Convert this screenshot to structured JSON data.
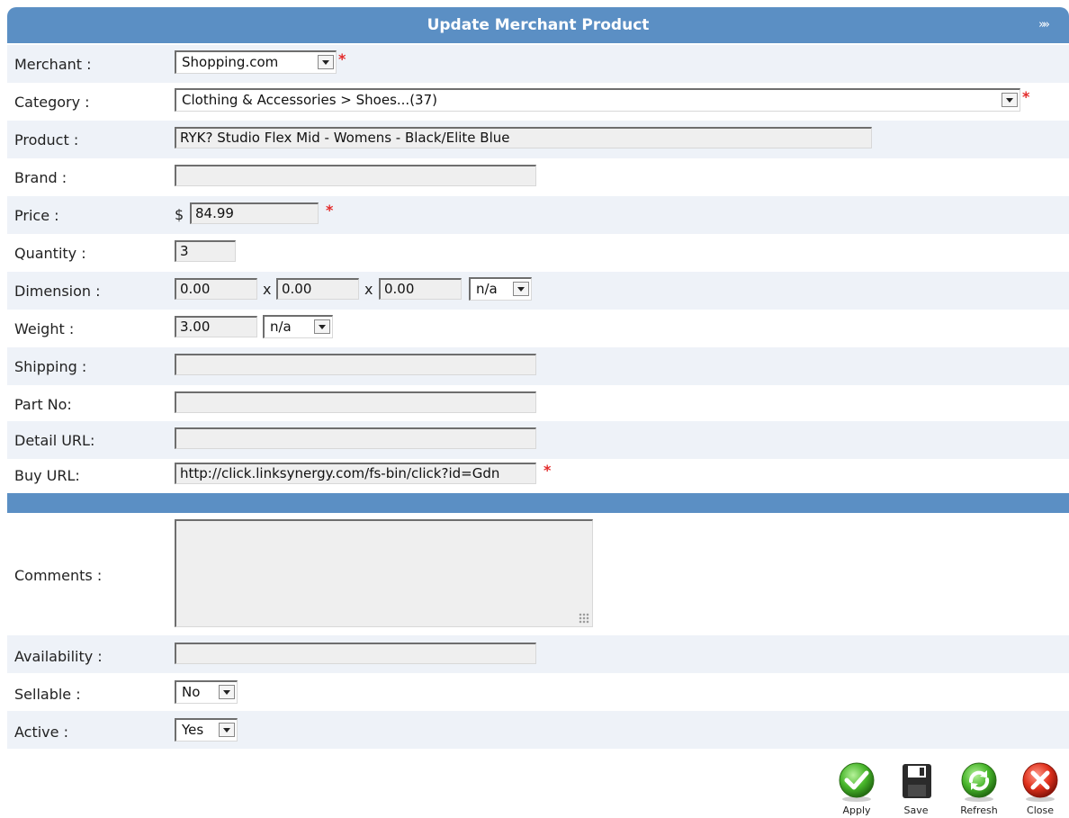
{
  "header": {
    "title": "Update Merchant Product",
    "chevrons": "»»"
  },
  "fields": {
    "merchant": {
      "label": "Merchant :",
      "value": "Shopping.com"
    },
    "category": {
      "label": "Category :",
      "value": "Clothing & Accessories > Shoes...(37)"
    },
    "product": {
      "label": "Product :",
      "value": "RYK? Studio Flex Mid - Womens - Black/Elite Blue"
    },
    "brand": {
      "label": "Brand :",
      "value": ""
    },
    "price": {
      "label": "Price :",
      "currency": "$",
      "value": "84.99"
    },
    "quantity": {
      "label": "Quantity :",
      "value": "3"
    },
    "dimension": {
      "label": "Dimension :",
      "x_sep": "x",
      "length": "0.00",
      "width": "0.00",
      "height": "0.00",
      "unit": "n/a"
    },
    "weight": {
      "label": "Weight :",
      "value": "3.00",
      "unit": "n/a"
    },
    "shipping": {
      "label": "Shipping :",
      "value": ""
    },
    "part_no": {
      "label": "Part No:",
      "value": ""
    },
    "detail_url": {
      "label": "Detail URL:",
      "value": ""
    },
    "buy_url": {
      "label": "Buy URL:",
      "value": "http://click.linksynergy.com/fs-bin/click?id=Gdn"
    },
    "comments": {
      "label": "Comments :",
      "value": ""
    },
    "availability": {
      "label": "Availability :",
      "value": ""
    },
    "sellable": {
      "label": "Sellable :",
      "value": "No"
    },
    "active": {
      "label": "Active :",
      "value": "Yes"
    }
  },
  "required_mark": "*",
  "actions": {
    "apply": "Apply",
    "save": "Save",
    "refresh": "Refresh",
    "close": "Close"
  },
  "colors": {
    "header": "#5b8fc4",
    "required": "#e32b2b",
    "row_shade": "#eef2f8"
  }
}
